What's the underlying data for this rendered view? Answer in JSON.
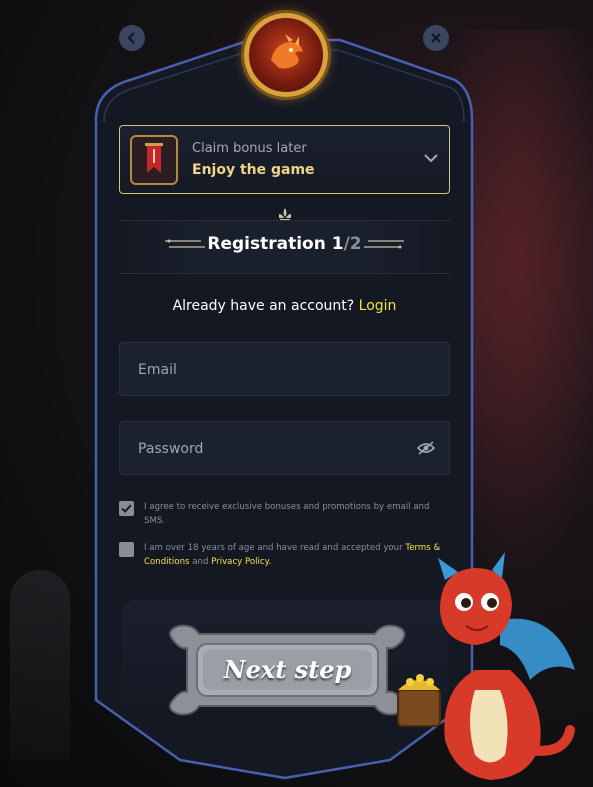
{
  "bonus": {
    "line1": "Claim bonus later",
    "line2": "Enjoy the game"
  },
  "registration": {
    "title": "Registration 1",
    "step_suffix": "/2"
  },
  "account": {
    "prompt": "Already have an account?",
    "login_label": "Login"
  },
  "form": {
    "email_placeholder": "Email",
    "password_placeholder": "Password"
  },
  "consents": {
    "promotions_text": "I agree to receive exclusive bonuses and promotions by email and SMS.",
    "promotions_checked": true,
    "age_text": "I am over 18 years of age and have read and accepted your",
    "terms_label": "Terms & Conditions",
    "and_text": "and",
    "privacy_label": "Privacy Policy.",
    "age_checked": false
  },
  "next_button": {
    "label": "Next step"
  },
  "colors": {
    "accent_yellow": "#f5e23c",
    "bonus_gold": "#f0d48a",
    "frame_blue": "#4a5fb0"
  }
}
